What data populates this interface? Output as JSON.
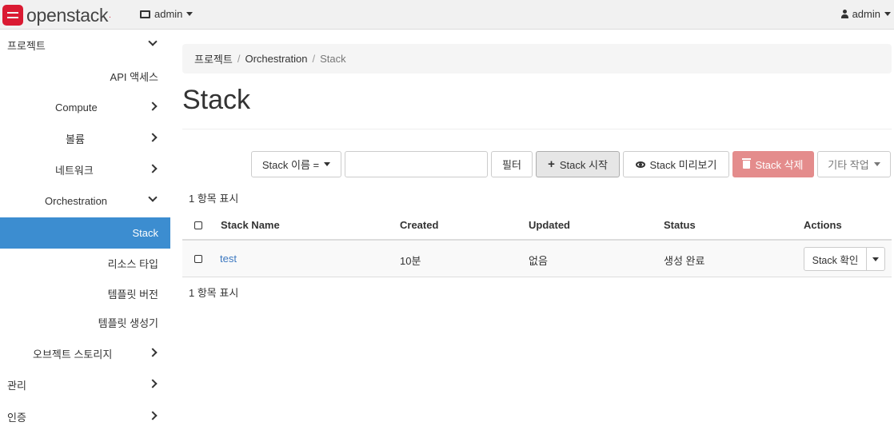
{
  "navbar": {
    "logo_text": "openstack",
    "project": "admin",
    "user": "admin"
  },
  "sidebar": {
    "items": [
      {
        "label": "프로젝트",
        "chevron": "down"
      },
      {
        "label": "API 액세스",
        "chevron": "none"
      },
      {
        "label": "Compute",
        "chevron": "right"
      },
      {
        "label": "볼륨",
        "chevron": "right"
      },
      {
        "label": "네트워크",
        "chevron": "right"
      },
      {
        "label": "Orchestration",
        "chevron": "down"
      },
      {
        "label": "Stack",
        "chevron": "none",
        "active": true
      },
      {
        "label": "리소스 타입",
        "chevron": "none"
      },
      {
        "label": "템플릿 버전",
        "chevron": "none"
      },
      {
        "label": "템플릿 생성기",
        "chevron": "none"
      },
      {
        "label": "오브젝트 스토리지",
        "chevron": "right"
      },
      {
        "label": "관리",
        "chevron": "right"
      },
      {
        "label": "인증",
        "chevron": "right"
      }
    ]
  },
  "breadcrumb": {
    "root": "프로젝트",
    "section": "Orchestration",
    "current": "Stack"
  },
  "page": {
    "title": "Stack"
  },
  "toolbar": {
    "filter_select": "Stack 이름 =",
    "search_value": "",
    "filter_button": "필터",
    "launch_button": "Stack 시작",
    "preview_button": "Stack 미리보기",
    "delete_button": "Stack 삭제",
    "more_actions": "기타 작업"
  },
  "table": {
    "count_top": "1 항목 표시",
    "count_bottom": "1 항목 표시",
    "headers": {
      "name": "Stack Name",
      "created": "Created",
      "updated": "Updated",
      "status": "Status",
      "actions": "Actions"
    },
    "rows": [
      {
        "name": "test",
        "created": "10분",
        "updated": "없음",
        "status": "생성 완료",
        "action": "Stack 확인"
      }
    ]
  },
  "colors": {
    "accent": "#3c8dd0",
    "danger": "#e48c8c",
    "brand": "#da1a32"
  }
}
